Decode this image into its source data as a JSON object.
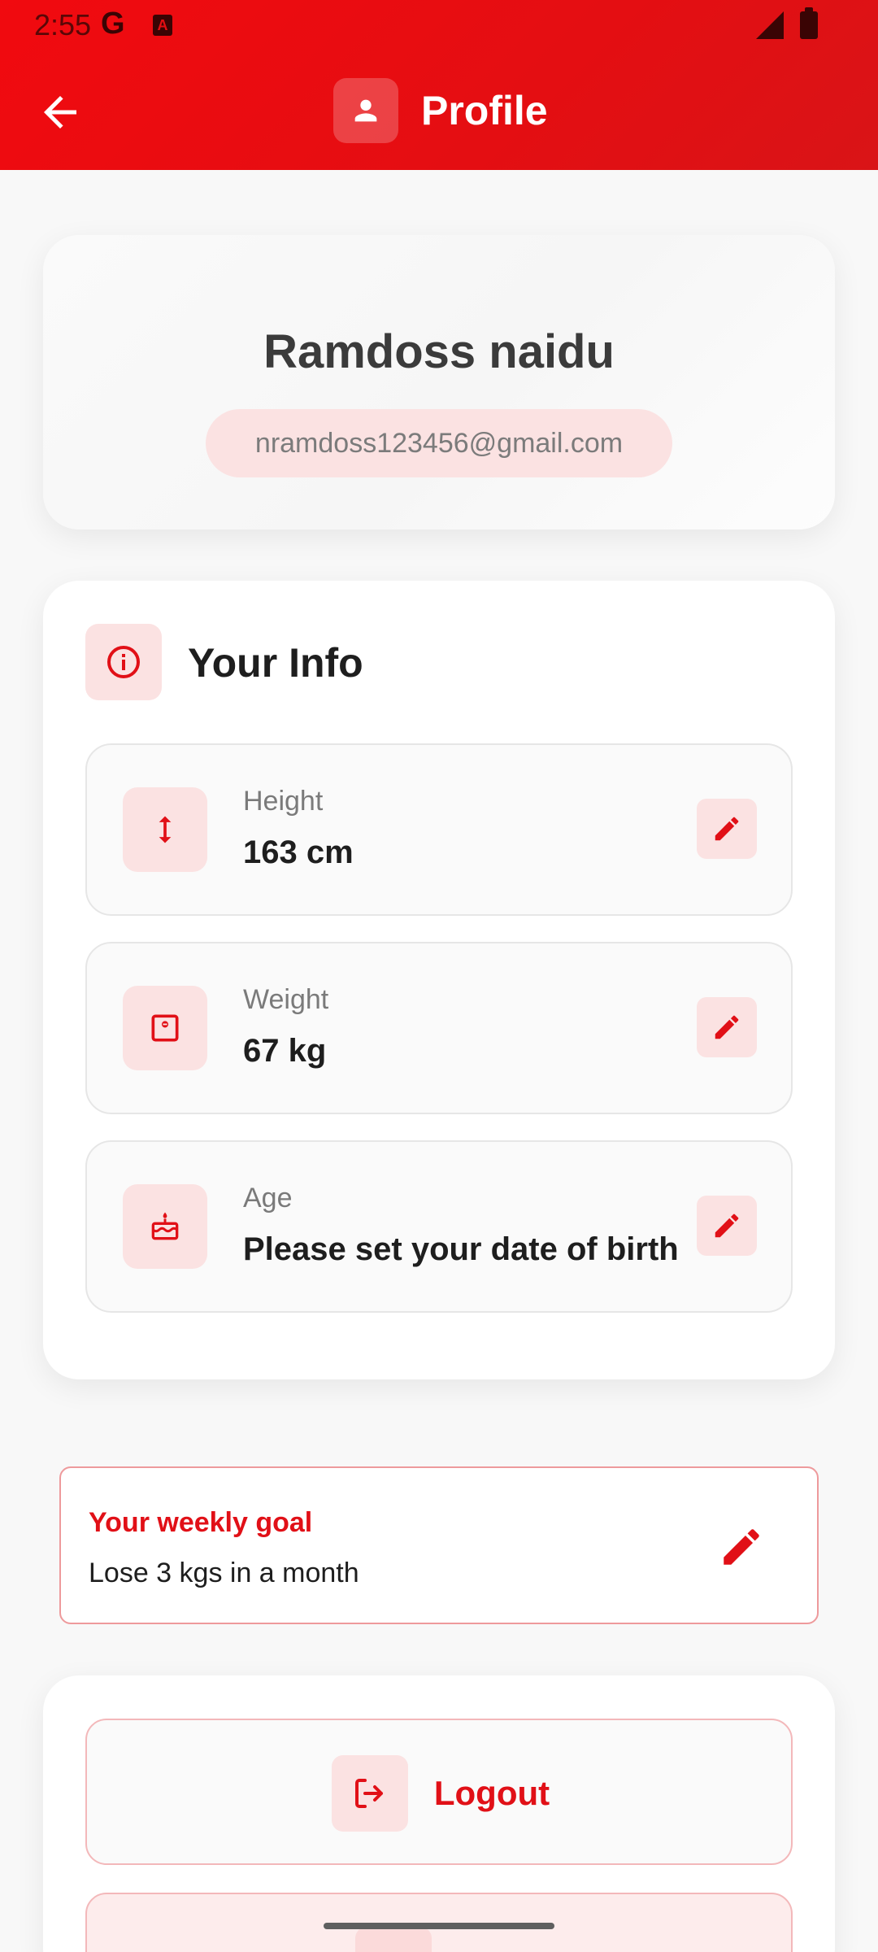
{
  "status_bar": {
    "time": "2:55",
    "google_glyph": "G",
    "a_glyph": "A"
  },
  "app_bar": {
    "title": "Profile",
    "back_icon": "arrow-left-icon",
    "title_icon": "person-icon"
  },
  "profile": {
    "name": "Ramdoss naidu",
    "email": "nramdoss123456@gmail.com"
  },
  "info": {
    "title": "Your Info",
    "title_icon": "info-icon",
    "rows": [
      {
        "label": "Height",
        "value": "163 cm",
        "icon": "vertical-arrows-icon"
      },
      {
        "label": "Weight",
        "value": "67 kg",
        "icon": "scale-icon"
      },
      {
        "label": "Age",
        "value": "Please set your date of birth",
        "icon": "cake-icon"
      }
    ]
  },
  "goal": {
    "title": "Your weekly goal",
    "text": "Lose 3 kgs in a month",
    "edit_icon": "pencil-icon"
  },
  "actions": {
    "logout_label": "Logout",
    "logout_icon": "logout-icon"
  },
  "colors": {
    "primary": "#e40e12",
    "accent_soft": "#fbe2e2",
    "background": "#f8f8f8"
  }
}
